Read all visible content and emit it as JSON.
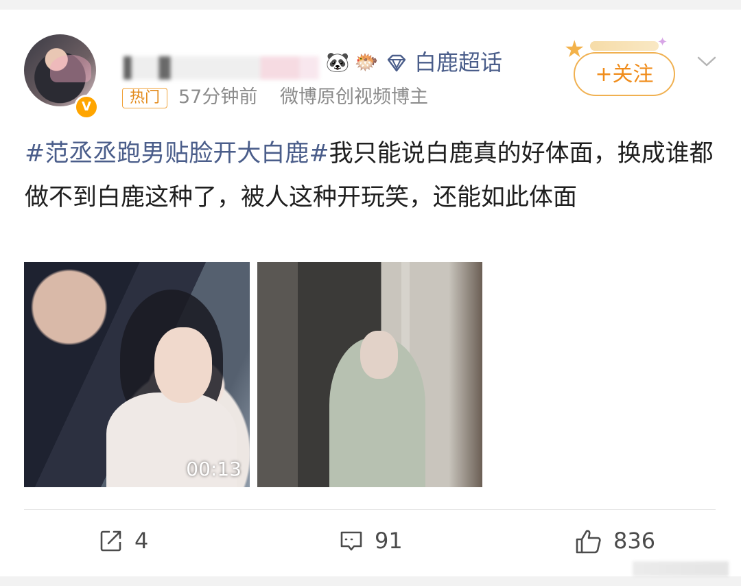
{
  "post": {
    "user": {
      "verified_mark": "V",
      "badges": [
        "panda-icon",
        "pufferfish-icon",
        "diamond-icon"
      ]
    },
    "supertopic_label": "白鹿超话",
    "follow_label": "+关注",
    "hot_badge": "热门",
    "time": "57分钟前",
    "source": "微博原创视频博主",
    "hashtag": "#范丞丞跑男贴脸开大白鹿#",
    "text": "我只能说白鹿真的好体面，换成谁都做不到白鹿这种了，被人这种开玩笑，还能如此体面",
    "media": [
      {
        "type": "video",
        "duration": "00:13"
      },
      {
        "type": "image"
      }
    ],
    "actions": {
      "repost_count": "4",
      "comment_count": "91",
      "like_count": "836"
    }
  },
  "colors": {
    "link": "#4a5d8a",
    "accent": "#f08c1a",
    "muted": "#8b8b8b"
  }
}
